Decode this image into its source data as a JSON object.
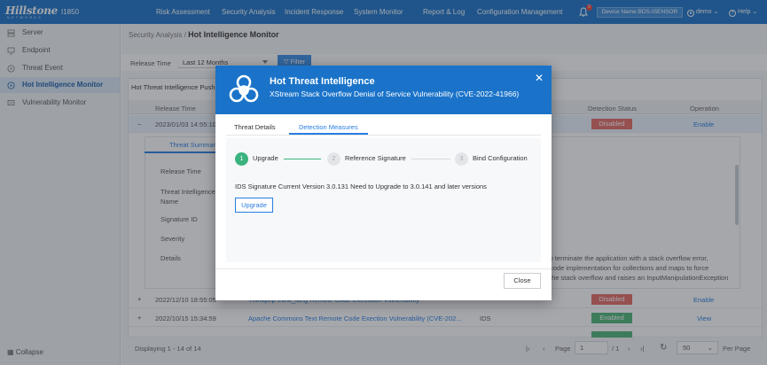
{
  "topbar": {
    "logo": "Hillstone",
    "logo_sub": "NETWORKS",
    "model": "I1850",
    "nav": [
      "Risk Assessment",
      "Security Analysis",
      "Incident Response",
      "System Monitor",
      "Report & Log",
      "Configuration Management"
    ],
    "bell_count": "2",
    "device": "Device Name:BDS-ISENSOR",
    "user": "demo",
    "help": "Help"
  },
  "sidebar": {
    "items": [
      {
        "label": "Server",
        "icon": "server-icon"
      },
      {
        "label": "Endpoint",
        "icon": "endpoint-icon"
      },
      {
        "label": "Threat Event",
        "icon": "biohazard-icon"
      },
      {
        "label": "Hot Intelligence Monitor",
        "icon": "biohazard-icon"
      },
      {
        "label": "Vulnerability Monitor",
        "icon": "monitor-icon"
      }
    ],
    "collapse": "Collapse"
  },
  "breadcrumb": {
    "parent": "Security Analysis /",
    "current": "Hot Intelligence Monitor"
  },
  "filter": {
    "release_time_label": "Release Time",
    "release_time_value": "Last 12 Months",
    "filter_button": "Filter"
  },
  "table": {
    "section_title": "Hot Threat Intelligence Push",
    "headers": {
      "release_time": "Release Time",
      "detection_status": "Detection Status",
      "operation": "Operation"
    },
    "rows": [
      {
        "time": "2023/01/03 14:55:10",
        "name": "",
        "type": "",
        "status": "Disabled",
        "status_color": "#e56a63",
        "op": "Enable"
      },
      {
        "time": "2022/12/10 18:55:05",
        "name": "Thinkphp think_lang Remote Code Execution Vulnerability",
        "type": "",
        "status": "Disabled",
        "status_color": "#e56a63",
        "op": "Enable"
      },
      {
        "time": "2022/10/15 15:34:59",
        "name": "Apache Commons Text Remote Code Exection Vulnerability (CVE-202...",
        "type": "IDS",
        "status": "Enabled",
        "status_color": "#4cb574",
        "op": "View"
      }
    ],
    "expanded": {
      "tab": "Threat Summary",
      "fields": [
        "Release Time",
        "Threat Intelligence Name",
        "Signature ID",
        "Severity",
        "Details"
      ],
      "details": [
        "ker to terminate the application with a stack overflow error,",
        "code implementation for collections and maps to force",
        "the stack overflow and raises an InputManipulationException"
      ]
    }
  },
  "footer": {
    "displaying": "Displaying 1 - 14 of 14",
    "page_label": "Page",
    "page_value": "1",
    "of_pages": "/ 1",
    "page_size": "50",
    "per_page": "Per Page"
  },
  "modal": {
    "title": "Hot Threat Intelligence",
    "subtitle": "XStream Stack Overflow Denial of Service Vulnerability (CVE-2022-41966)",
    "tabs": [
      "Threat Details",
      "Detection Measures"
    ],
    "steps": [
      {
        "num": "1",
        "label": "Upgrade"
      },
      {
        "num": "2",
        "label": "Reference Signature"
      },
      {
        "num": "3",
        "label": "Bind Configuration"
      }
    ],
    "ids_text": "IDS Signature  Current Version 3.0.131   Need to Upgrade to  3.0.141   and later versions",
    "upgrade_button": "Upgrade",
    "close_button": "Close",
    "accent": "#1a73c9",
    "step_done_color": "#3bb37f"
  }
}
